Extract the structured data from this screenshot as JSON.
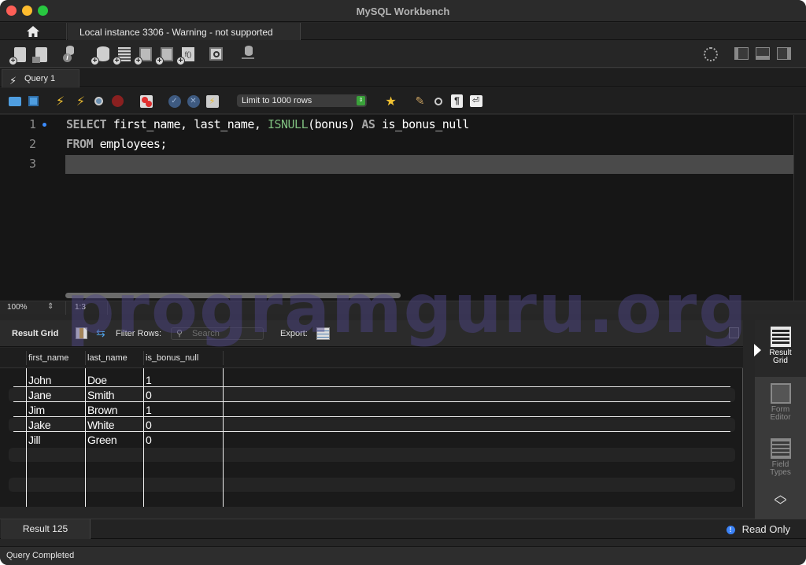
{
  "window": {
    "title": "MySQL Workbench"
  },
  "connection_tabs": {
    "home_icon": "home-icon",
    "active_tab": "Local instance 3306 - Warning - not supported"
  },
  "main_toolbar": {
    "icons": [
      "new-sql-tab-icon",
      "open-sql-script-icon",
      "schema-inspector-icon",
      "create-schema-icon",
      "create-table-icon",
      "create-view-icon",
      "create-procedure-icon",
      "create-function-icon",
      "search-table-data-icon",
      "reconnect-icon"
    ],
    "right_icons": [
      "preferences-gear-icon",
      "toggle-sidebar-icon",
      "toggle-output-panel-icon",
      "toggle-secondary-sidebar-icon"
    ]
  },
  "query_tabs": [
    {
      "label": "Query 1",
      "icon": "bolt-icon",
      "active": true
    }
  ],
  "sql_toolbar": {
    "icons": [
      "open-file-icon",
      "save-file-icon",
      "execute-icon",
      "execute-current-icon",
      "explain-icon",
      "stop-icon",
      "toggle-error-stop-icon",
      "commit-icon",
      "rollback-icon",
      "autocommit-icon"
    ],
    "limit_select": "Limit to 1000 rows",
    "right_icons": [
      "add-snippet-icon",
      "beautify-icon",
      "find-icon",
      "invisible-chars-icon",
      "word-wrap-icon"
    ]
  },
  "editor": {
    "lines": [
      {
        "number": "1",
        "tokens": [
          {
            "t": "SELECT",
            "c": "kw"
          },
          {
            "t": " first_name, last_name, ",
            "c": ""
          },
          {
            "t": "ISNULL",
            "c": "fn"
          },
          {
            "t": "(bonus) ",
            "c": ""
          },
          {
            "t": "AS",
            "c": "kw"
          },
          {
            "t": " is_bonus_null",
            "c": ""
          }
        ]
      },
      {
        "number": "2",
        "tokens": [
          {
            "t": "FROM",
            "c": "kw"
          },
          {
            "t": " employees;",
            "c": ""
          }
        ]
      },
      {
        "number": "3",
        "tokens": []
      }
    ],
    "zoom": "100%",
    "cursor_position": "1:3"
  },
  "result_toolbar": {
    "result_grid_label": "Result Grid",
    "filter_label": "Filter Rows:",
    "search_placeholder": "Search",
    "export_label": "Export:"
  },
  "result_grid": {
    "columns": [
      "first_name",
      "last_name",
      "is_bonus_null"
    ],
    "rows": [
      [
        "John",
        "Doe",
        "1"
      ],
      [
        "Jane",
        "Smith",
        "0"
      ],
      [
        "Jim",
        "Brown",
        "1"
      ],
      [
        "Jake",
        "White",
        "0"
      ],
      [
        "Jill",
        "Green",
        "0"
      ]
    ]
  },
  "side_panel": {
    "buttons": [
      {
        "label_1": "Result",
        "label_2": "Grid",
        "active": true
      },
      {
        "label_1": "Form",
        "label_2": "Editor",
        "active": false
      },
      {
        "label_1": "Field",
        "label_2": "Types",
        "active": false
      }
    ]
  },
  "result_tabs": {
    "active_tab": "Result 125",
    "read_only": "Read Only"
  },
  "status_bar": {
    "text": "Query Completed"
  },
  "watermark": "programguru.org",
  "colors": {
    "keyword": "#a6a6a6",
    "function": "#7fbf7f",
    "limit_stepper": "#3aa23a",
    "info": "#3b82f6"
  }
}
